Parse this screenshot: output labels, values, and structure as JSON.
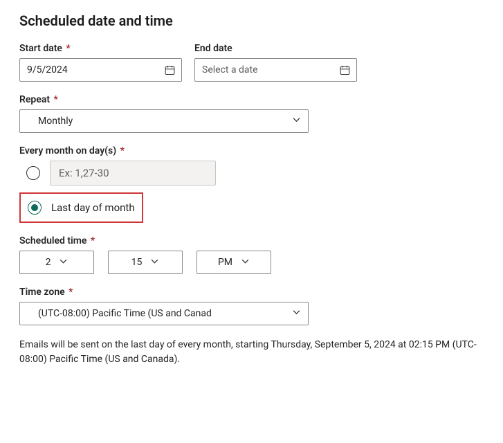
{
  "title": "Scheduled date and time",
  "fields": {
    "start_date": {
      "label": "Start date",
      "value": "9/5/2024",
      "required": true
    },
    "end_date": {
      "label": "End date",
      "placeholder": "Select a date",
      "required": false
    },
    "repeat": {
      "label": "Repeat",
      "value": "Monthly",
      "required": true
    },
    "every_month": {
      "label": "Every month on day(s)",
      "required": true,
      "options": {
        "days_input_placeholder": "Ex: 1,27-30",
        "last_day_label": "Last day of month"
      },
      "selected": "last_day"
    },
    "scheduled_time": {
      "label": "Scheduled time",
      "required": true,
      "hour": "2",
      "minute": "15",
      "ampm": "PM"
    },
    "timezone": {
      "label": "Time zone",
      "required": true,
      "value": "(UTC-08:00) Pacific Time (US and Canad"
    }
  },
  "summary": "Emails will be sent on the last day of every month, starting Thursday, September 5, 2024 at 02:15 PM (UTC-08:00) Pacific Time (US and Canada)."
}
